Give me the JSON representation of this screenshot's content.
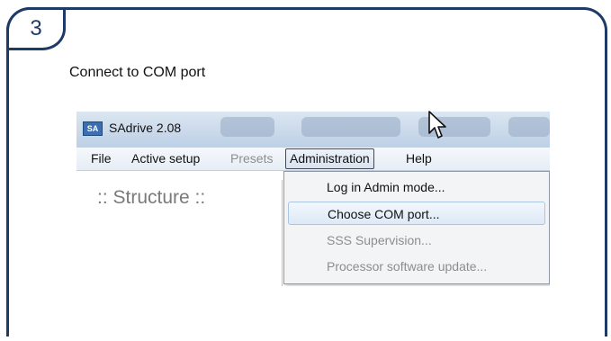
{
  "step": {
    "number": "3"
  },
  "instruction": "Connect to COM port",
  "window": {
    "app_icon_text": "SA",
    "title": "SAdrive 2.08"
  },
  "menubar": {
    "items": [
      {
        "label": "File",
        "disabled": false
      },
      {
        "label": "Active setup",
        "disabled": false
      },
      {
        "label": "Presets",
        "disabled": true
      },
      {
        "label": "Administration",
        "disabled": false,
        "active": true
      },
      {
        "label": "Help",
        "disabled": false
      }
    ]
  },
  "panel": {
    "structure_label": ":: Structure ::"
  },
  "dropdown": {
    "items": [
      {
        "label": "Log in Admin mode...",
        "disabled": false
      },
      {
        "label": "Choose COM port...",
        "disabled": false,
        "highlighted": true
      },
      {
        "label": "SSS Supervision...",
        "disabled": true
      },
      {
        "label": "Processor software update...",
        "disabled": true
      }
    ]
  },
  "colors": {
    "border": "#1e3a66",
    "highlight": "#dde9f7",
    "disabled_text": "#8d8d8d"
  },
  "icons": {
    "cursor": "mouse-pointer-icon",
    "app": "sadrive-app-icon"
  }
}
